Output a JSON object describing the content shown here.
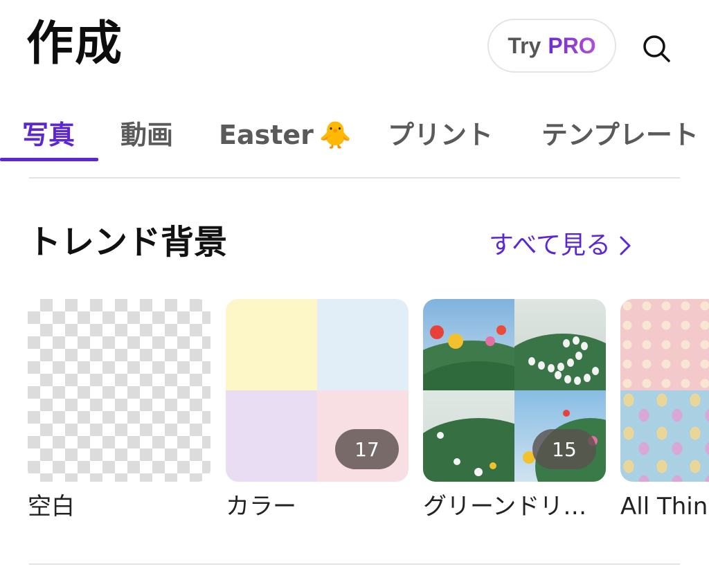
{
  "header": {
    "title": "作成",
    "try_label": "Try",
    "pro_label": "PRO"
  },
  "tabs": [
    {
      "label": "写真",
      "active": true
    },
    {
      "label": "動画",
      "active": false
    },
    {
      "label": "Easter",
      "emoji": "🐥",
      "active": false
    },
    {
      "label": "プリント",
      "active": false
    },
    {
      "label": "テンプレート",
      "active": false
    }
  ],
  "section": {
    "title": "トレンド背景",
    "see_all": "すべて見る"
  },
  "cards": [
    {
      "label": "空白"
    },
    {
      "label": "カラー",
      "count": "17"
    },
    {
      "label": "グリーンドリ…",
      "count": "15"
    },
    {
      "label": "All Things"
    }
  ],
  "colors": {
    "accent": "#5b27d4",
    "color_quads": [
      "#fdf7c8",
      "#e2eef7",
      "#e8ddf2",
      "#f7dfe3"
    ]
  },
  "icons": {
    "search": "search-icon",
    "chevron": "chevron-right-icon"
  }
}
